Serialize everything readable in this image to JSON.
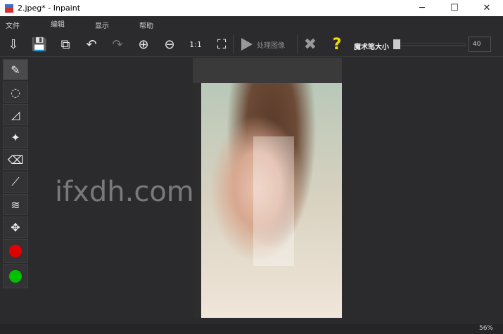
{
  "window": {
    "title": "2.jpeg* - Inpaint",
    "min": "─",
    "max": "☐",
    "close": "✕"
  },
  "menu": [
    "文件",
    "编辑",
    "显示",
    "帮助"
  ],
  "toolbar": {
    "process_label": "处理图像",
    "brush_size_label": "魔术笔大小",
    "brush_size_value": "40",
    "brush_size_fraction": 0.05
  },
  "colors": {
    "red": "#e00000",
    "green": "#00c000",
    "help": "#f0e000"
  },
  "watermark": "ifxdh.com",
  "status": {
    "zoom": "56%"
  }
}
